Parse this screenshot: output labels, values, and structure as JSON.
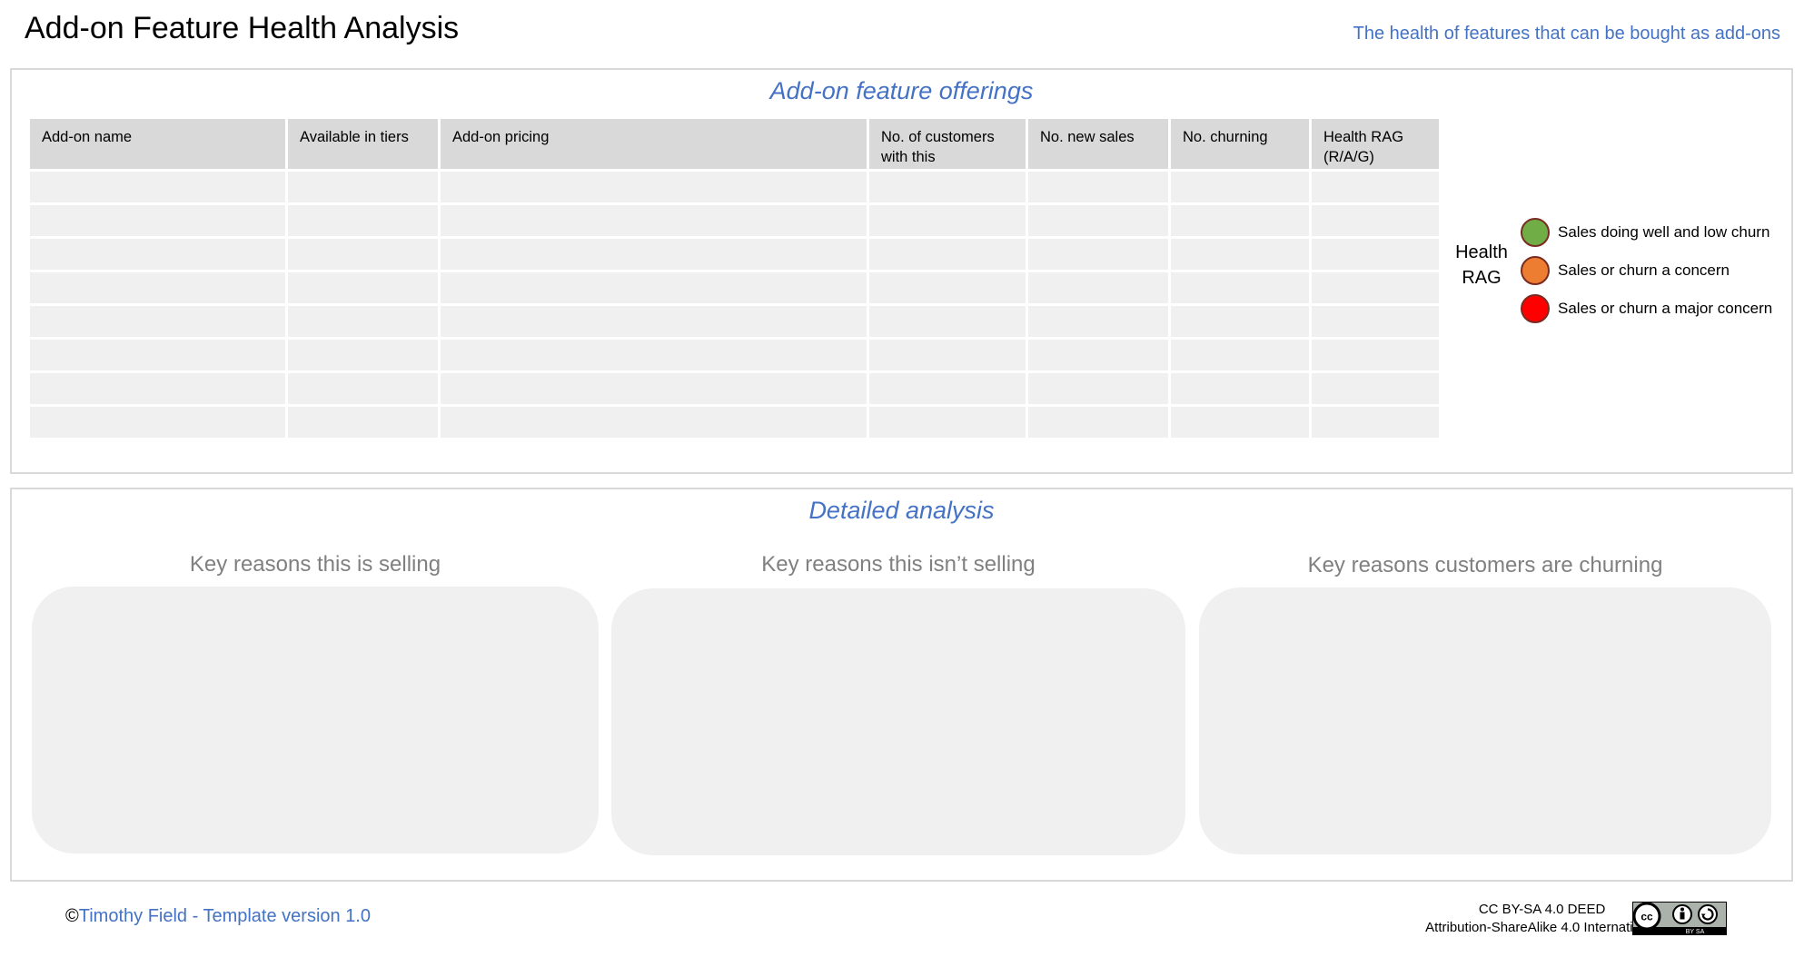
{
  "header": {
    "title": "Add-on Feature Health Analysis",
    "subtitle": "The health of features that can be bought as add-ons"
  },
  "offerings": {
    "section_title": "Add-on feature offerings",
    "columns": [
      "Add-on name",
      "Available in tiers",
      "Add-on pricing",
      "No. of customers with this",
      "No. new sales",
      "No. churning",
      "Health RAG (R/A/G)"
    ],
    "rows": [
      [
        "",
        "",
        "",
        "",
        "",
        "",
        ""
      ],
      [
        "",
        "",
        "",
        "",
        "",
        "",
        ""
      ],
      [
        "",
        "",
        "",
        "",
        "",
        "",
        ""
      ],
      [
        "",
        "",
        "",
        "",
        "",
        "",
        ""
      ],
      [
        "",
        "",
        "",
        "",
        "",
        "",
        ""
      ],
      [
        "",
        "",
        "",
        "",
        "",
        "",
        ""
      ],
      [
        "",
        "",
        "",
        "",
        "",
        "",
        ""
      ],
      [
        "",
        "",
        "",
        "",
        "",
        "",
        ""
      ]
    ]
  },
  "legend": {
    "title": "Health RAG",
    "items": [
      {
        "label": "Sales doing well and low churn",
        "color": "#70ad47"
      },
      {
        "label": "Sales or churn a concern",
        "color": "#ed7d31"
      },
      {
        "label": "Sales or churn a major concern",
        "color": "#ff0000"
      }
    ]
  },
  "analysis": {
    "section_title": "Detailed analysis",
    "columns": [
      {
        "heading": "Key reasons this is selling",
        "content": ""
      },
      {
        "heading": "Key reasons this isn’t selling",
        "content": ""
      },
      {
        "heading": "Key reasons customers are churning",
        "content": ""
      }
    ]
  },
  "footer": {
    "copyright_symbol": "©",
    "copyright_text": "Timothy Field - Template version 1.0",
    "license_line1": "CC BY-SA 4.0 DEED",
    "license_line2": "Attribution-ShareAlike 4.0 International",
    "badge_text": "BY SA"
  },
  "colors": {
    "accent": "#4472c4",
    "header_cell": "#d9d9d9",
    "body_cell": "#f0f0f0"
  }
}
